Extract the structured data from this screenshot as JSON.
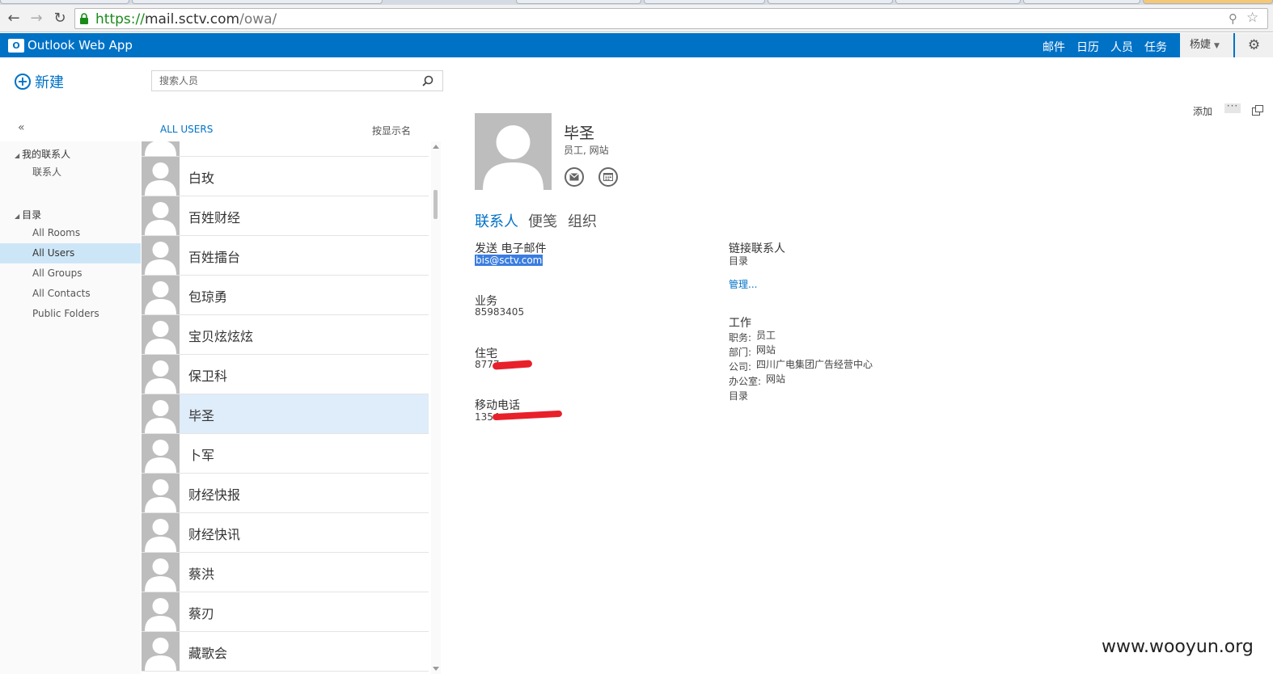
{
  "browser": {
    "url_scheme": "https://",
    "url_host": "mail.sctv.com",
    "url_path": "/owa/"
  },
  "app": {
    "logo_letters": "O",
    "title": "Outlook Web App",
    "nav": [
      "邮件",
      "日历",
      "人员",
      "任务"
    ],
    "active_nav": "人员",
    "user_name": "杨婕"
  },
  "sidebar": {
    "new_label": "新建",
    "collapse": "«",
    "my_contacts": "我的联系人",
    "contacts": "联系人",
    "directory": "目录",
    "items": [
      "All Rooms",
      "All Users",
      "All Groups",
      "All Contacts",
      "Public Folders"
    ],
    "selected": "All Users"
  },
  "search": {
    "placeholder": "搜索人员"
  },
  "list": {
    "filter": "ALL USERS",
    "sort": "按显示名",
    "people": [
      "白玫",
      "百姓财经",
      "百姓擂台",
      "包琼勇",
      "宝贝炫炫炫",
      "保卫科",
      "毕圣",
      "卜军",
      "财经快报",
      "财经快讯",
      "蔡洪",
      "蔡刃",
      "藏歌会"
    ],
    "selected": "毕圣"
  },
  "reading": {
    "add_label": "添加",
    "more": "···",
    "name": "毕圣",
    "subtitle": "员工, 网站",
    "tabs": [
      "联系人",
      "便笺",
      "组织"
    ],
    "send_email_label": "发送 电子邮件",
    "email": "bis@sctv.com",
    "business_label": "业务",
    "business_phone": "85983405",
    "home_label": "住宅",
    "home_phone_visible": "8777",
    "mobile_label": "移动电话",
    "mobile_phone_visible": "1354",
    "linked_label": "链接联系人",
    "linked_value": "目录",
    "manage_link": "管理...",
    "work_label": "工作",
    "work": {
      "title_key": "职务:",
      "title_val": "员工",
      "dept_key": "部门:",
      "dept_val": "网站",
      "company_key": "公司:",
      "company_val": "四川广电集团广告经营中心",
      "office_key": "办公室:",
      "office_val": "网站",
      "source": "目录"
    }
  },
  "watermark": "www.wooyun.org",
  "colors": {
    "brand": "#0072c6",
    "selected_row": "#dfecf9",
    "selected_folder": "#cde6f7",
    "redaction": "#e8202a"
  }
}
